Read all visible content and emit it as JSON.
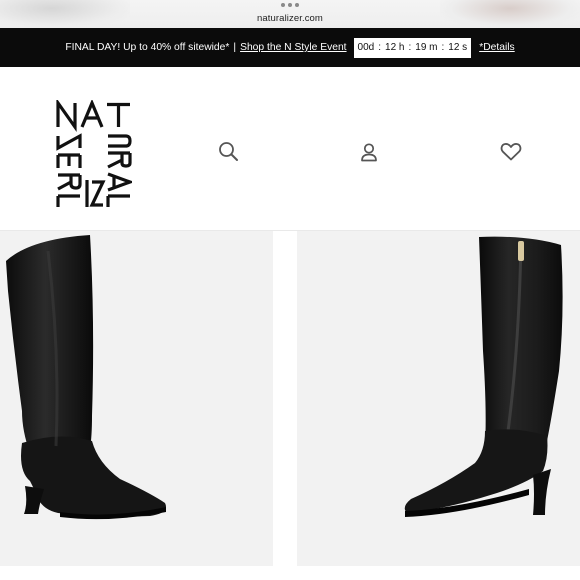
{
  "browser": {
    "url": "naturalizer.com"
  },
  "promo": {
    "message": "FINAL DAY! Up to 40% off sitewide*",
    "separator": "|",
    "event_link": "Shop the N Style Event",
    "countdown": {
      "days": "00d",
      "hours": "12 h",
      "minutes": "19 m",
      "seconds": "12 s"
    },
    "details_link": "*Details"
  },
  "header": {
    "logo": {
      "brand": "NATURALIZER",
      "row1": "NAT",
      "col2": "URAL",
      "row3": "IZER"
    },
    "icons": [
      "search-icon",
      "account-icon",
      "heart-icon"
    ]
  },
  "products": [
    {
      "image": "black-knee-high-boot-side-view"
    },
    {
      "image": "black-knee-high-boot-inner-zipper-view"
    }
  ],
  "colors": {
    "banner_bg": "#0b0b0b",
    "banner_text": "#ffffff",
    "panel_bg": "#f2f2f2",
    "boot": "#1a1a1a"
  }
}
